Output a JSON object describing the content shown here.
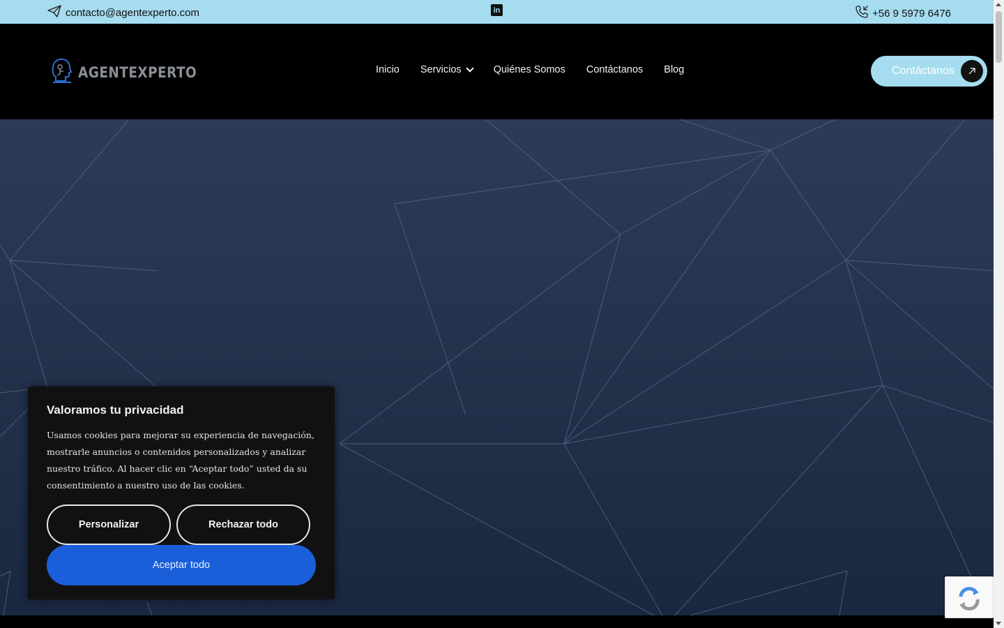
{
  "topbar": {
    "email": "contacto@agentexperto.com",
    "phone": "+56 9 5979 6476",
    "linkedin_icon": "in"
  },
  "header": {
    "logo_text": "AGENTEXPERTO",
    "nav": [
      {
        "label": "Inicio"
      },
      {
        "label": "Servicios"
      },
      {
        "label": "Quiénes Somos"
      },
      {
        "label": "Contáctanos"
      },
      {
        "label": "Blog"
      }
    ],
    "cta_label": "Contáctanos"
  },
  "cookie": {
    "title": "Valoramos tu privacidad",
    "text": "Usamos cookies para mejorar su experiencia de navegación, mostrarle anuncios o contenidos personalizados y analizar nuestro tráfico. Al hacer clic en “Aceptar todo” usted da su consentimiento a nuestro uso de las cookies.",
    "customize_label": "Personalizar",
    "reject_label": "Rechazar todo",
    "accept_label": "Aceptar todo"
  },
  "colors": {
    "topbar_bg": "#a6dcef",
    "accept_button": "#1a5fd9",
    "hero_bg": "#2c3b57"
  },
  "icons": {
    "email": "paper-plane-icon",
    "phone": "phone-call-icon",
    "linkedin": "linkedin-icon",
    "cta_arrow": "arrow-up-right-icon",
    "services_dropdown": "chevron-down-icon"
  }
}
